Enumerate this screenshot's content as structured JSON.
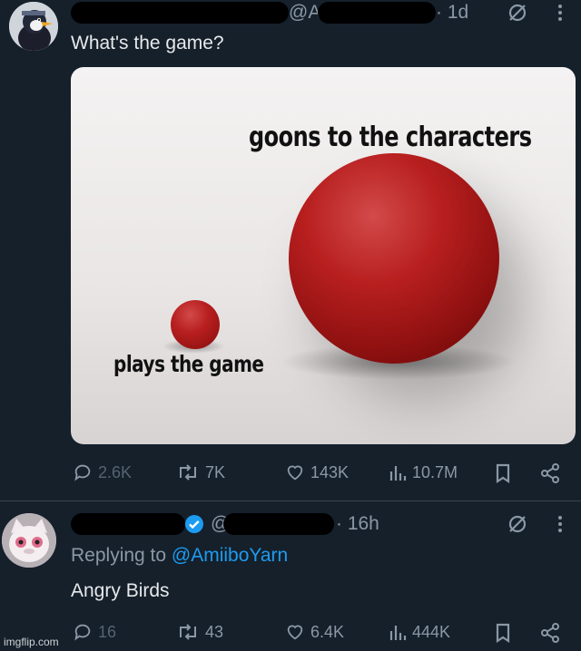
{
  "tweet1": {
    "handle": "@A",
    "time": "· 1d",
    "text": "What's the game?",
    "image": {
      "label_big": "goons to the characters",
      "label_small": "plays the game"
    },
    "actions": {
      "replies": "2.6K",
      "reposts": "7K",
      "likes": "143K",
      "views": "10.7M"
    }
  },
  "tweet2": {
    "handle": "@",
    "time": "· 16h",
    "replying_prefix": "Replying to",
    "replying_mention": "@AmiiboYarn",
    "text": "Angry Birds",
    "actions": {
      "replies": "16",
      "reposts": "43",
      "likes": "6.4K",
      "views": "444K"
    }
  },
  "watermark": "imgflip.com",
  "colors": {
    "background": "#15202b",
    "text": "#e7e9ea",
    "muted": "#8b98a5",
    "accent": "#1d9bf0",
    "ball": "#b81f1f"
  }
}
